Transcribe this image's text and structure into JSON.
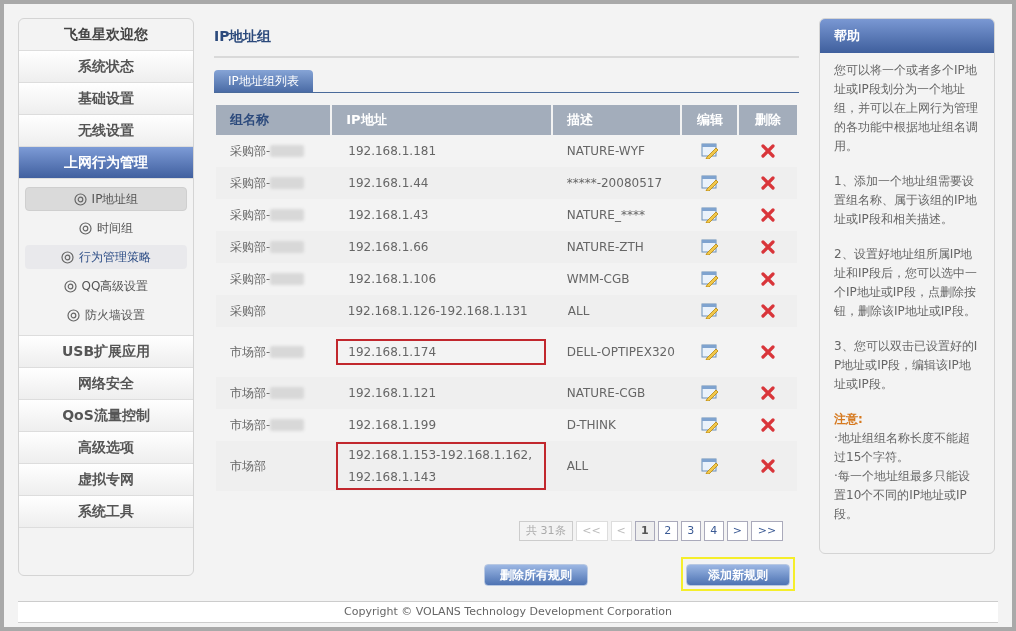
{
  "sidebar": {
    "title": "飞鱼星欢迎您",
    "items": [
      {
        "label": "系统状态",
        "selected": false
      },
      {
        "label": "基础设置",
        "selected": false
      },
      {
        "label": "无线设置",
        "selected": false
      },
      {
        "label": "上网行为管理",
        "selected": true,
        "children": [
          {
            "label": "IP地址组",
            "selected": true,
            "hovered": false
          },
          {
            "label": "时间组",
            "selected": false,
            "hovered": false
          },
          {
            "label": "行为管理策略",
            "selected": false,
            "hovered": true
          },
          {
            "label": "QQ高级设置",
            "selected": false,
            "hovered": false
          },
          {
            "label": "防火墙设置",
            "selected": false,
            "hovered": false
          }
        ]
      },
      {
        "label": "USB扩展应用",
        "selected": false
      },
      {
        "label": "网络安全",
        "selected": false
      },
      {
        "label": "QoS流量控制",
        "selected": false
      },
      {
        "label": "高级选项",
        "selected": false
      },
      {
        "label": "虚拟专网",
        "selected": false
      },
      {
        "label": "系统工具",
        "selected": false
      }
    ]
  },
  "page": {
    "title": "IP地址组",
    "tabs": [
      {
        "label": "IP地址组列表",
        "selected": true
      }
    ]
  },
  "table": {
    "columns": [
      "组名称",
      "IP地址",
      "描述",
      "编辑",
      "删除"
    ],
    "rows": [
      {
        "group": "采购部-",
        "name_blurred": true,
        "ip": "192.168.1.181",
        "description": "NATURE-WYF",
        "highlighted": false
      },
      {
        "group": "采购部-",
        "name_blurred": true,
        "ip": "192.168.1.44",
        "description": "*****-20080517",
        "highlighted": false
      },
      {
        "group": "采购部-",
        "name_blurred": true,
        "ip": "192.168.1.43",
        "description": "NATURE_****",
        "highlighted": false
      },
      {
        "group": "采购部-",
        "name_blurred": true,
        "ip": "192.168.1.66",
        "description": "NATURE-ZTH",
        "highlighted": false
      },
      {
        "group": "采购部-",
        "name_blurred": true,
        "ip": "192.168.1.106",
        "description": "WMM-CGB",
        "highlighted": false
      },
      {
        "group": "采购部",
        "name_blurred": false,
        "ip": "192.168.1.126-192.168.1.131",
        "description": "ALL",
        "highlighted": false
      },
      {
        "group": "市场部-",
        "name_blurred": true,
        "ip": "192.168.1.174",
        "description": "DELL-OPTIPEX320",
        "highlighted": true
      },
      {
        "group": "市场部-",
        "name_blurred": true,
        "ip": "192.168.1.121",
        "description": "NATURE-CGB",
        "highlighted": false
      },
      {
        "group": "市场部-",
        "name_blurred": true,
        "ip": "192.168.1.199",
        "description": "D-THINK",
        "highlighted": false
      },
      {
        "group": "市场部",
        "name_blurred": false,
        "ip": "192.168.1.153-192.168.1.162,192.168.1.143",
        "description": "ALL",
        "highlighted": true
      }
    ]
  },
  "pagination": {
    "total": "共 31条",
    "buttons": [
      {
        "label": "<<",
        "disabled": true,
        "selected": false
      },
      {
        "label": "<",
        "disabled": true,
        "selected": false
      },
      {
        "label": "1",
        "disabled": false,
        "selected": true
      },
      {
        "label": "2",
        "disabled": false,
        "selected": false
      },
      {
        "label": "3",
        "disabled": false,
        "selected": false
      },
      {
        "label": "4",
        "disabled": false,
        "selected": false
      },
      {
        "label": ">",
        "disabled": false,
        "selected": false
      },
      {
        "label": ">>",
        "disabled": false,
        "selected": false
      }
    ]
  },
  "actions": [
    {
      "label": "删除所有规则",
      "highlighted": false
    },
    {
      "label": "添加新规则",
      "highlighted": true
    }
  ],
  "help": {
    "title": "帮助",
    "paragraphs": [
      "您可以将一个或者多个IP地址或IP段划分为一个地址组，并可以在上网行为管理的各功能中根据地址组名调用。",
      "1、添加一个地址组需要设置组名称、属于该组的IP地址或IP段和相关描述。",
      "2、设置好地址组所属IP地址和IP段后，您可以选中一个IP地址或IP段，点删除按钮，删除该IP地址或IP段。",
      "3、您可以双击已设置好的IP地址或IP段，编辑该IP地址或IP段。"
    ],
    "note_title": "注意:",
    "notes": [
      "·地址组组名称长度不能超过15个字符。",
      "·每一个地址组最多只能设置10个不同的IP地址或IP段。"
    ]
  },
  "footer": "Copyright © VOLANS Technology Development Corporation"
}
